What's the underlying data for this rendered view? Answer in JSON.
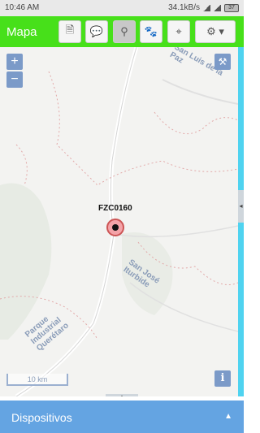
{
  "status_bar": {
    "time": "10:46 AM",
    "network_speed": "34.1kB/s",
    "battery": "37"
  },
  "app_bar": {
    "title": "Mapa",
    "buttons": [
      {
        "name": "document-icon",
        "glyph": "🗎"
      },
      {
        "name": "chat-icon",
        "glyph": "💬"
      },
      {
        "name": "map-pin-icon",
        "glyph": "⚲"
      },
      {
        "name": "paw-icon",
        "glyph": "🐾"
      },
      {
        "name": "crosshair-icon",
        "glyph": "⌖"
      },
      {
        "name": "gear-icon",
        "glyph": "⚙ ▾"
      }
    ]
  },
  "map": {
    "zoom_in": "+",
    "zoom_out": "−",
    "hammer_icon": "⚒",
    "info_icon": "i",
    "scale_label": "10 km",
    "place_labels": {
      "san_luis": "San Luis de la\nPaz",
      "san_jose": "San José\nIturbide",
      "parque": "Parque\nIndustrial\nQuerétaro"
    },
    "marker_label": "FZC0160",
    "side_handle": "◂",
    "bottom_handle": "▴"
  },
  "footer": {
    "label": "Dispositivos",
    "caret": "▲"
  },
  "colors": {
    "app_bar": "#47e01a",
    "map_frame": "#4fd3f0",
    "footer": "#64a4e2",
    "map_controls": "#7b9ac8",
    "marker_fill": "#f4a3a8"
  }
}
